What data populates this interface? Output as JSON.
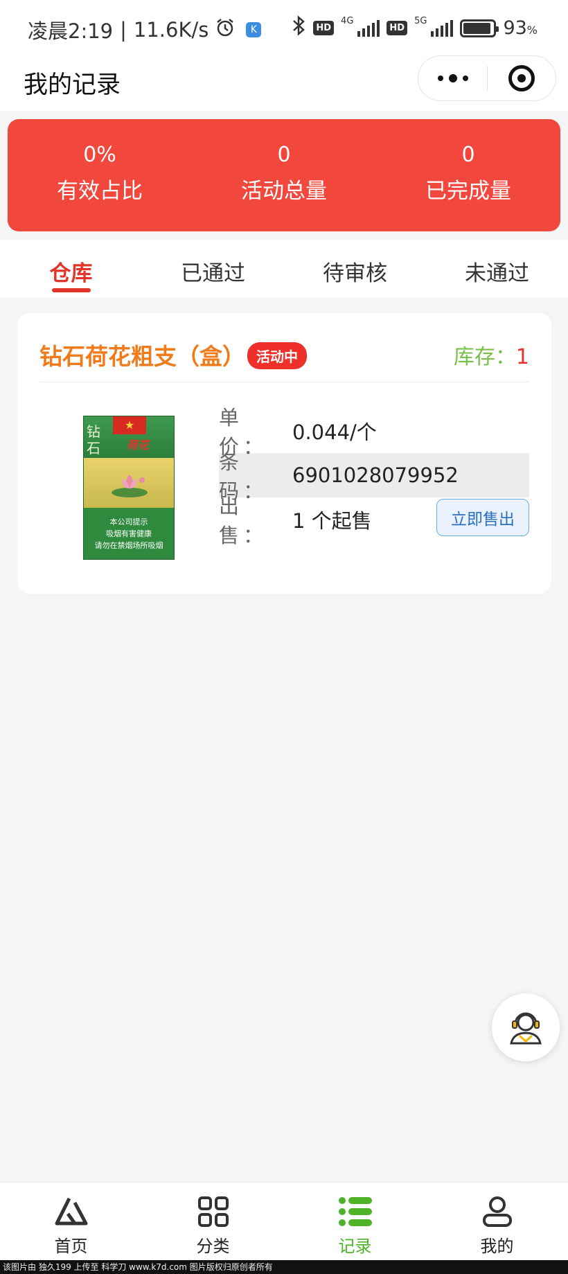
{
  "status_bar": {
    "time": "凌晨2:19",
    "speed": "11.6K/s",
    "alarm_icon": "alarm-clock-icon",
    "k_badge": "K",
    "hd1": "HD",
    "net1": "4G",
    "hd2": "HD",
    "net2": "5G",
    "battery": "93",
    "battery_unit": "%"
  },
  "header": {
    "title": "我的记录"
  },
  "stats": [
    {
      "value": "0%",
      "label": "有效占比"
    },
    {
      "value": "0",
      "label": "活动总量"
    },
    {
      "value": "0",
      "label": "已完成量"
    }
  ],
  "tabs": [
    {
      "label": "仓库",
      "active": true
    },
    {
      "label": "已通过",
      "active": false
    },
    {
      "label": "待审核",
      "active": false
    },
    {
      "label": "未通过",
      "active": false
    }
  ],
  "product": {
    "name": "钻石荷花粗支（盒）",
    "badge": "活动中",
    "stock_label": "库存：",
    "stock_value": "1",
    "price_label": "单 价：",
    "price_value": "0.044/个",
    "barcode_label": "条 码：",
    "barcode_value": "6901028079952",
    "sale_label": "出 售：",
    "sale_value": "1 个起售",
    "sell_button": "立即售出",
    "pack": {
      "side_text": "钻石",
      "brand": "荷花",
      "warning_1": "本公司提示",
      "warning_2": "吸烟有害健康",
      "warning_3": "请勿在禁烟场所吸烟"
    }
  },
  "bottom_nav": [
    {
      "label": "首页",
      "icon": "home-logo-icon",
      "active": false
    },
    {
      "label": "分类",
      "icon": "grid-icon",
      "active": false
    },
    {
      "label": "记录",
      "icon": "list-icon",
      "active": true
    },
    {
      "label": "我的",
      "icon": "user-icon",
      "active": false
    }
  ],
  "footer": "该图片由 独久199 上传至 科学刀 www.k7d.com 图片版权归原创者所有",
  "colors": {
    "banner": "#f2473d",
    "tab_active": "#e3342a",
    "product_name": "#ef7b1a",
    "stock_label": "#78c04a",
    "nav_active": "#4fb32a"
  }
}
